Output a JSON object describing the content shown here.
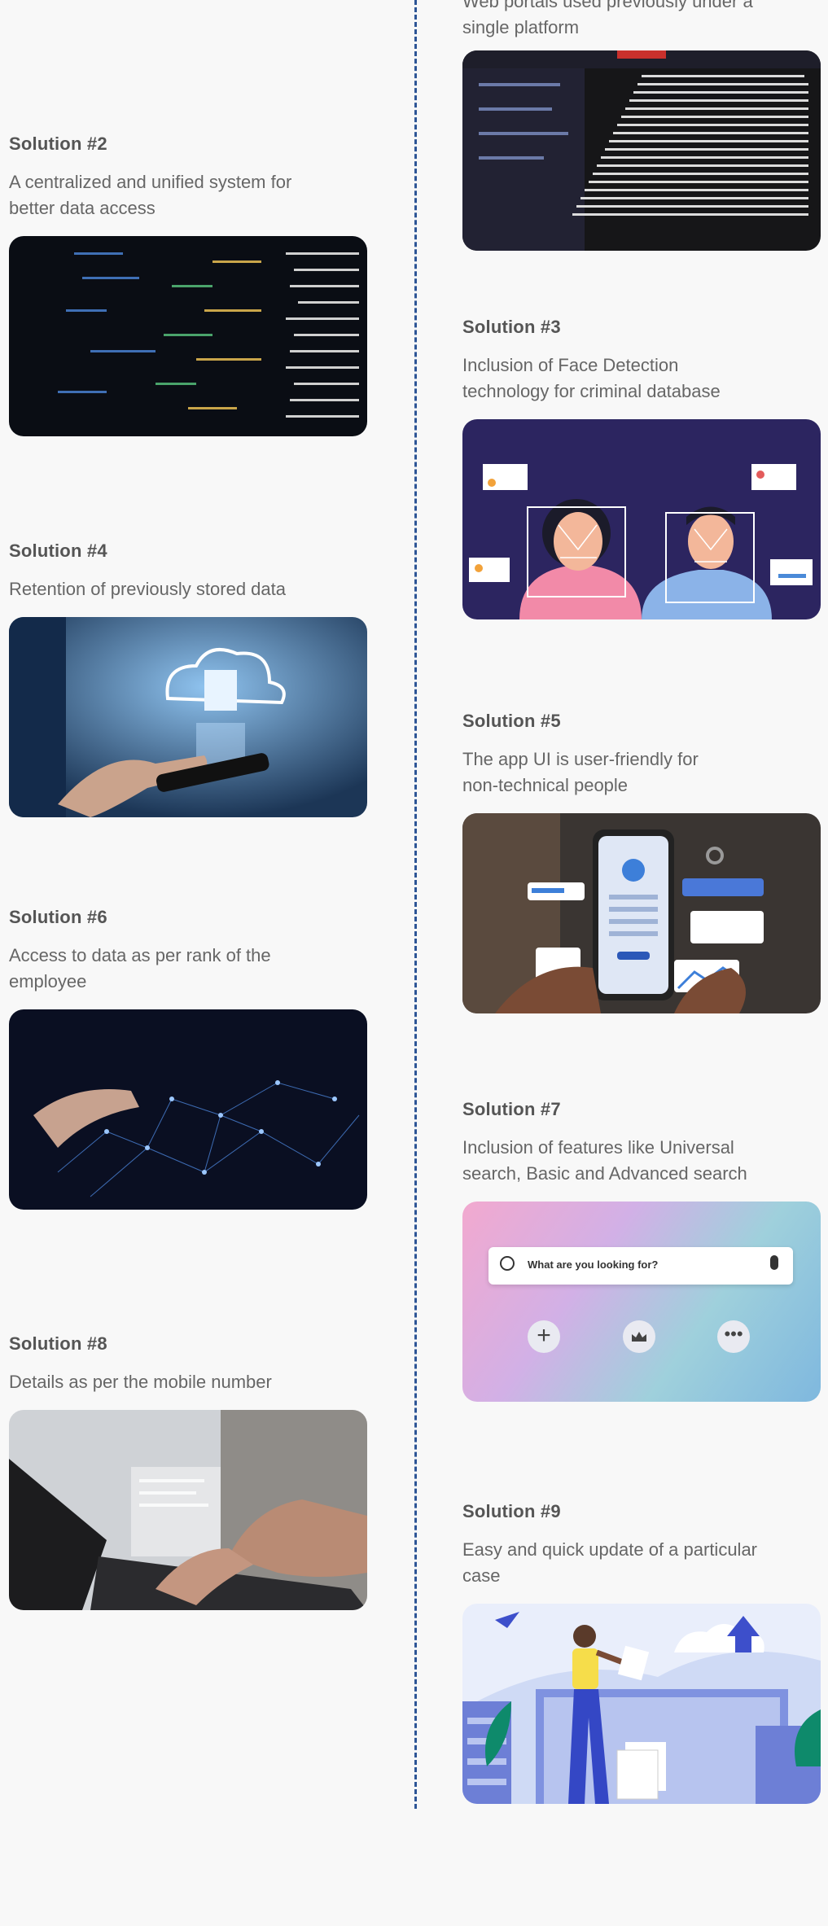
{
  "intro": {
    "desc_line1": "Web portals used previously under a",
    "desc_line2": "single platform"
  },
  "solutions": [
    {
      "title": "Solution #2",
      "desc": [
        "A centralized and unified system for",
        "better data access"
      ]
    },
    {
      "title": "Solution #3",
      "desc": [
        "Inclusion of Face Detection",
        "technology for criminal database"
      ]
    },
    {
      "title": "Solution #4",
      "desc": [
        "Retention of previously stored data"
      ]
    },
    {
      "title": "Solution #5",
      "desc": [
        "The app UI is user-friendly for",
        "non-technical people"
      ]
    },
    {
      "title": "Solution #6",
      "desc": [
        "Access to data as per rank of the",
        "employee"
      ]
    },
    {
      "title": "Solution #7",
      "desc": [
        "Inclusion of features like Universal",
        "search, Basic and Advanced search"
      ]
    },
    {
      "title": "Solution #8",
      "desc": [
        "Details as per the mobile number"
      ]
    },
    {
      "title": "Solution #9",
      "desc": [
        "Easy and quick update of a particular",
        "case"
      ]
    }
  ],
  "search_mock": {
    "placeholder": "What are you looking for?"
  },
  "colors": {
    "timeline": "#2d5596",
    "face_bg": "#2c2560",
    "search_grad_start": "#f2a9cf",
    "search_grad_end": "#7fb8de"
  }
}
